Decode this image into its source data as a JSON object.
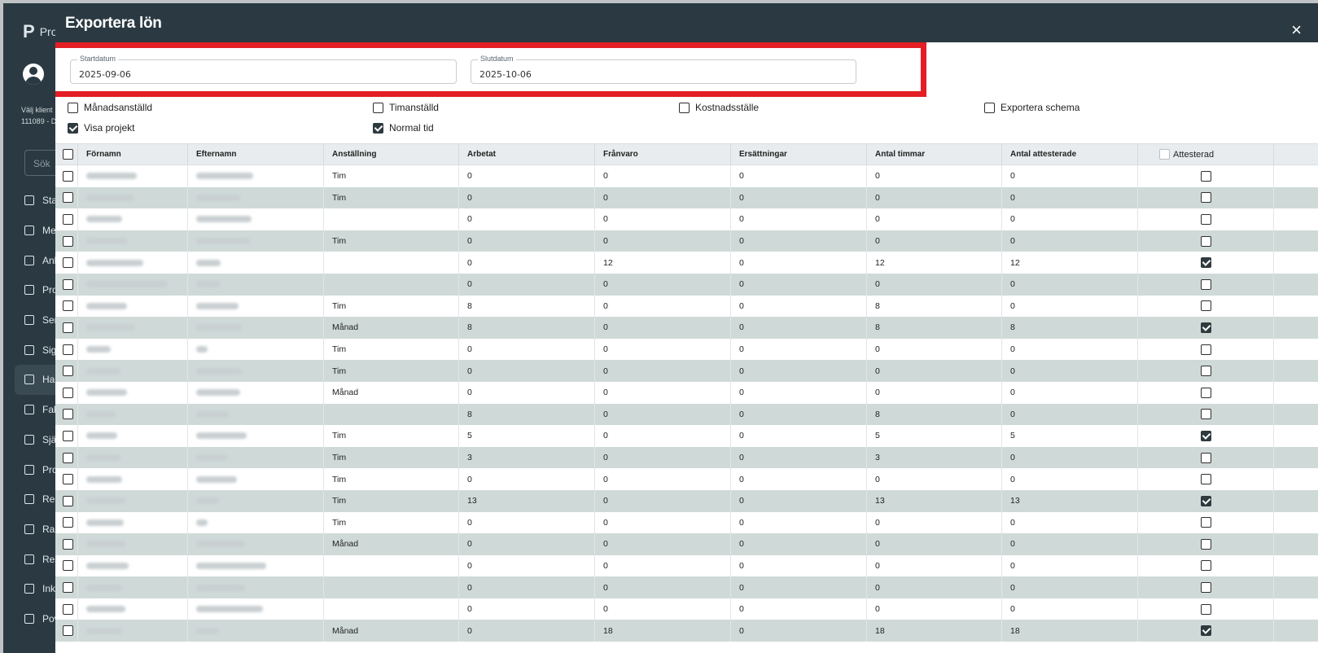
{
  "app": {
    "logo_text": "Proj",
    "client_label": "Välj klient",
    "client_value": "111089 - D",
    "search_placeholder": "Sök",
    "nav": [
      "Sta",
      "Me",
      "Anb",
      "Pro",
      "Ser",
      "Sig",
      "Ha",
      "Fak",
      "Sjä",
      "Pro",
      "Reg",
      "Rap",
      "Res",
      "Ink",
      "Pov"
    ]
  },
  "modal": {
    "title": "Exportera lön",
    "close": "×",
    "start_label": "Startdatum",
    "start_value": "2025-09-06",
    "end_label": "Slutdatum",
    "end_value": "2025-10-06",
    "options": [
      {
        "label": "Månadsanställd",
        "checked": false
      },
      {
        "label": "Timanställd",
        "checked": false
      },
      {
        "label": "Kostnadsställe",
        "checked": false
      },
      {
        "label": "Exportera schema",
        "checked": false
      },
      {
        "label": "Visa projekt",
        "checked": true
      },
      {
        "label": "Normal tid",
        "checked": true
      }
    ]
  },
  "table": {
    "headers": [
      "Förnamn",
      "Efternamn",
      "Anställning",
      "Arbetat",
      "Frånvaro",
      "Ersättningar",
      "Antal timmar",
      "Antal attesterade",
      "Attesterad"
    ],
    "rows": [
      {
        "anst": "Tim",
        "arbetat": "0",
        "franvaro": "0",
        "ers": "0",
        "timmar": "0",
        "attest": "0",
        "ok": false
      },
      {
        "anst": "Tim",
        "arbetat": "0",
        "franvaro": "0",
        "ers": "0",
        "timmar": "0",
        "attest": "0",
        "ok": false
      },
      {
        "anst": "",
        "arbetat": "0",
        "franvaro": "0",
        "ers": "0",
        "timmar": "0",
        "attest": "0",
        "ok": false
      },
      {
        "anst": "Tim",
        "arbetat": "0",
        "franvaro": "0",
        "ers": "0",
        "timmar": "0",
        "attest": "0",
        "ok": false
      },
      {
        "anst": "",
        "arbetat": "0",
        "franvaro": "12",
        "ers": "0",
        "timmar": "12",
        "attest": "12",
        "ok": true
      },
      {
        "anst": "",
        "arbetat": "0",
        "franvaro": "0",
        "ers": "0",
        "timmar": "0",
        "attest": "0",
        "ok": false
      },
      {
        "anst": "Tim",
        "arbetat": "8",
        "franvaro": "0",
        "ers": "0",
        "timmar": "8",
        "attest": "0",
        "ok": false
      },
      {
        "anst": "Månad",
        "arbetat": "8",
        "franvaro": "0",
        "ers": "0",
        "timmar": "8",
        "attest": "8",
        "ok": true
      },
      {
        "anst": "Tim",
        "arbetat": "0",
        "franvaro": "0",
        "ers": "0",
        "timmar": "0",
        "attest": "0",
        "ok": false
      },
      {
        "anst": "Tim",
        "arbetat": "0",
        "franvaro": "0",
        "ers": "0",
        "timmar": "0",
        "attest": "0",
        "ok": false
      },
      {
        "anst": "Månad",
        "arbetat": "0",
        "franvaro": "0",
        "ers": "0",
        "timmar": "0",
        "attest": "0",
        "ok": false
      },
      {
        "anst": "",
        "arbetat": "8",
        "franvaro": "0",
        "ers": "0",
        "timmar": "8",
        "attest": "0",
        "ok": false
      },
      {
        "anst": "Tim",
        "arbetat": "5",
        "franvaro": "0",
        "ers": "0",
        "timmar": "5",
        "attest": "5",
        "ok": true
      },
      {
        "anst": "Tim",
        "arbetat": "3",
        "franvaro": "0",
        "ers": "0",
        "timmar": "3",
        "attest": "0",
        "ok": false
      },
      {
        "anst": "Tim",
        "arbetat": "0",
        "franvaro": "0",
        "ers": "0",
        "timmar": "0",
        "attest": "0",
        "ok": false
      },
      {
        "anst": "Tim",
        "arbetat": "13",
        "franvaro": "0",
        "ers": "0",
        "timmar": "13",
        "attest": "13",
        "ok": true
      },
      {
        "anst": "Tim",
        "arbetat": "0",
        "franvaro": "0",
        "ers": "0",
        "timmar": "0",
        "attest": "0",
        "ok": false
      },
      {
        "anst": "Månad",
        "arbetat": "0",
        "franvaro": "0",
        "ers": "0",
        "timmar": "0",
        "attest": "0",
        "ok": false
      },
      {
        "anst": "",
        "arbetat": "0",
        "franvaro": "0",
        "ers": "0",
        "timmar": "0",
        "attest": "0",
        "ok": false
      },
      {
        "anst": "",
        "arbetat": "0",
        "franvaro": "0",
        "ers": "0",
        "timmar": "0",
        "attest": "0",
        "ok": false
      },
      {
        "anst": "",
        "arbetat": "0",
        "franvaro": "0",
        "ers": "0",
        "timmar": "0",
        "attest": "0",
        "ok": false
      },
      {
        "anst": "Månad",
        "arbetat": "0",
        "franvaro": "18",
        "ers": "0",
        "timmar": "18",
        "attest": "18",
        "ok": true
      }
    ]
  }
}
